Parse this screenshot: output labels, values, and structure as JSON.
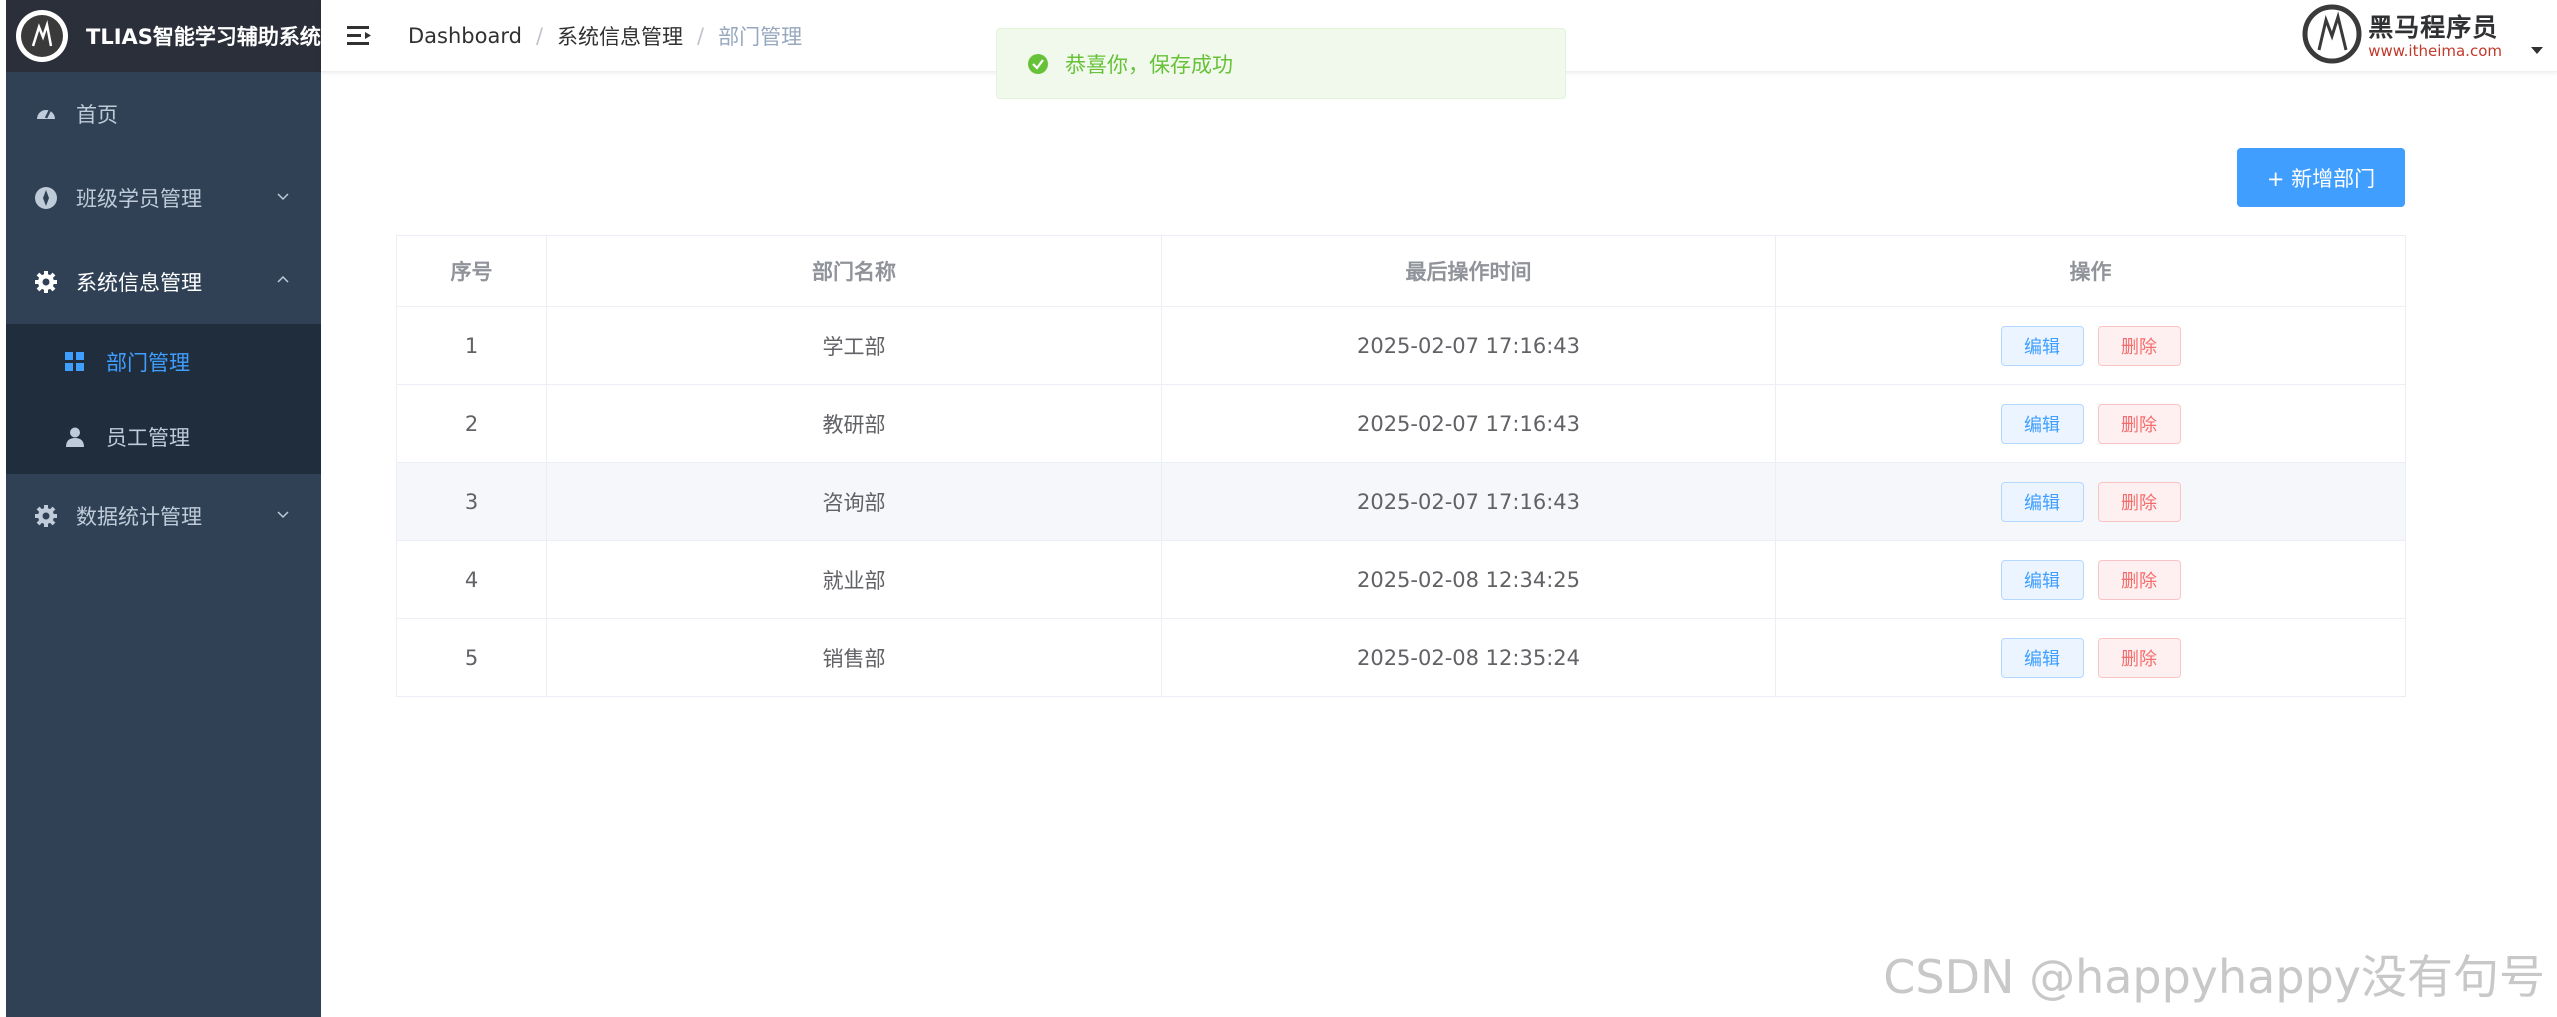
{
  "sidebar": {
    "title": "TLIAS智能学习辅助系统",
    "items": [
      {
        "label": "首页"
      },
      {
        "label": "班级学员管理"
      },
      {
        "label": "系统信息管理"
      },
      {
        "label": "数据统计管理"
      }
    ],
    "submenu": [
      {
        "label": "部门管理"
      },
      {
        "label": "员工管理"
      }
    ],
    "active_color": "#409eff"
  },
  "header": {
    "breadcrumb": [
      "Dashboard",
      "系统信息管理",
      "部门管理"
    ],
    "breadcrumb_sep": "/",
    "brand_name": "黑马程序员",
    "brand_url": "www.itheima.com"
  },
  "toast": {
    "message": "恭喜你，保存成功"
  },
  "toolbar": {
    "add_label": "+ 新增部门"
  },
  "table": {
    "columns": [
      "序号",
      "部门名称",
      "最后操作时间",
      "操作"
    ],
    "rows": [
      {
        "no": "1",
        "name": "学工部",
        "time": "2025-02-07 17:16:43"
      },
      {
        "no": "2",
        "name": "教研部",
        "time": "2025-02-07 17:16:43"
      },
      {
        "no": "3",
        "name": "咨询部",
        "time": "2025-02-07 17:16:43"
      },
      {
        "no": "4",
        "name": "就业部",
        "time": "2025-02-08 12:34:25"
      },
      {
        "no": "5",
        "name": "销售部",
        "time": "2025-02-08 12:35:24"
      }
    ],
    "edit_label": "编辑",
    "delete_label": "删除"
  },
  "watermark": "CSDN @happyhappy没有句号"
}
